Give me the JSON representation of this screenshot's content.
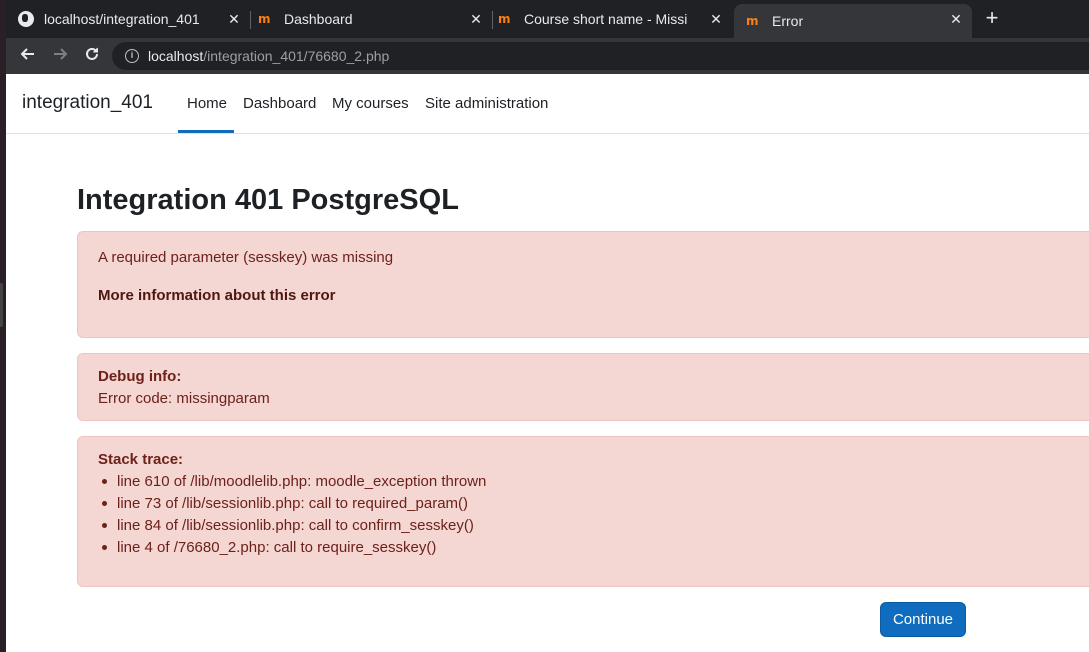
{
  "browser": {
    "tabs": [
      {
        "label": "localhost/integration_401",
        "favicon": "globe-icon",
        "active": false
      },
      {
        "label": "Dashboard",
        "favicon": "moodle-icon",
        "active": false
      },
      {
        "label": "Course short name - Missi",
        "favicon": "moodle-icon",
        "active": false
      },
      {
        "label": "Error",
        "favicon": "moodle-icon",
        "active": true
      }
    ],
    "close_glyph": "✕",
    "new_tab_glyph": "+",
    "url_host": "localhost",
    "url_path": "/integration_401/76680_2.php"
  },
  "navbar": {
    "brand": "integration_401",
    "items": [
      {
        "label": "Home",
        "active": true
      },
      {
        "label": "Dashboard"
      },
      {
        "label": "My courses"
      },
      {
        "label": "Site administration"
      }
    ]
  },
  "main": {
    "title": "Integration 401 PostgreSQL",
    "error_message": "A required parameter (sesskey) was missing",
    "more_info_link": "More information about this error",
    "debug_heading": "Debug info:",
    "debug_code": "Error code: missingparam",
    "stack_heading": "Stack trace:",
    "stack_trace": [
      "line 610 of /lib/moodlelib.php: moodle_exception thrown",
      "line 73 of /lib/sessionlib.php: call to required_param()",
      "line 84 of /lib/sessionlib.php: call to confirm_sesskey()",
      "line 4 of /76680_2.php: call to require_sesskey()"
    ],
    "continue_label": "Continue"
  },
  "colors": {
    "accent": "#0f6cbf",
    "alert_bg": "#f4d6d2",
    "alert_text": "#6e211a"
  }
}
